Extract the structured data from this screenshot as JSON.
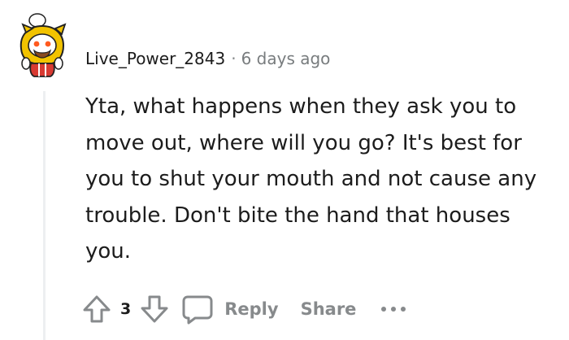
{
  "comment": {
    "author": "Live_Power_2843",
    "separator": "·",
    "timestamp": "6 days ago",
    "body": "Yta, what happens when they ask you to move out, where will you go? It's best for you to shut your mouth and not cause any trouble. Don't bite the hand that houses you.",
    "votes": "3"
  },
  "actions": {
    "reply_label": "Reply",
    "share_label": "Share"
  },
  "icons": {
    "upvote": "arrow-up-icon",
    "downvote": "arrow-down-icon",
    "reply": "speech-bubble-icon",
    "more": "ellipsis-icon",
    "avatar": "snoo-avatar"
  },
  "colors": {
    "text": "#1c1c1c",
    "meta": "#787c7e",
    "action": "#878a8c",
    "thread_line": "#edeff1",
    "avatar_hat": "#f2c300",
    "avatar_shirt": "#d83a32"
  }
}
